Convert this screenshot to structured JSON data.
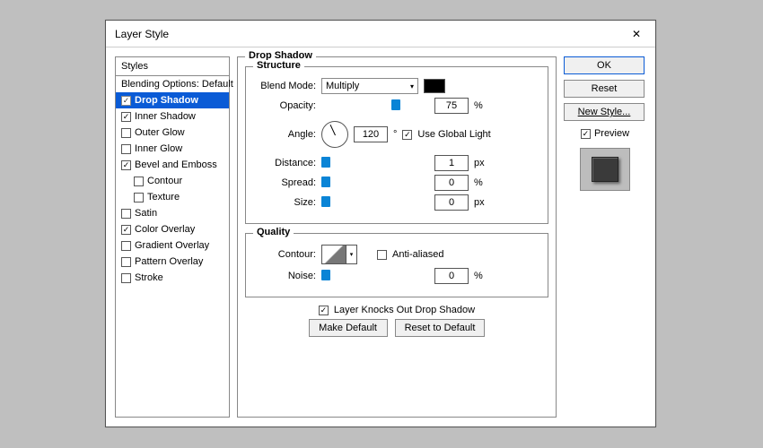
{
  "dialog": {
    "title": "Layer Style"
  },
  "styles": {
    "header": "Styles",
    "blending": "Blending Options: Default",
    "dropShadow": "Drop Shadow",
    "innerShadow": "Inner Shadow",
    "outerGlow": "Outer Glow",
    "innerGlow": "Inner Glow",
    "bevel": "Bevel and Emboss",
    "contour": "Contour",
    "texture": "Texture",
    "satin": "Satin",
    "colorOverlay": "Color Overlay",
    "gradientOverlay": "Gradient Overlay",
    "patternOverlay": "Pattern Overlay",
    "stroke": "Stroke"
  },
  "panel": {
    "groupTitle": "Drop Shadow",
    "structure": "Structure",
    "blendMode": "Blend Mode:",
    "blendValue": "Multiply",
    "opacity": "Opacity:",
    "opacityValue": "75",
    "percent": "%",
    "angle": "Angle:",
    "angleValue": "120",
    "degree": "°",
    "useGlobal": "Use Global Light",
    "distance": "Distance:",
    "distanceValue": "1",
    "px": "px",
    "spread": "Spread:",
    "spreadValue": "0",
    "size": "Size:",
    "sizeValue": "0",
    "quality": "Quality",
    "contour": "Contour:",
    "antialiased": "Anti-aliased",
    "noise": "Noise:",
    "noiseValue": "0",
    "knocksOut": "Layer Knocks Out Drop Shadow",
    "makeDefault": "Make Default",
    "resetDefault": "Reset to Default"
  },
  "buttons": {
    "ok": "OK",
    "reset": "Reset",
    "newStyle": "New Style...",
    "preview": "Preview"
  }
}
